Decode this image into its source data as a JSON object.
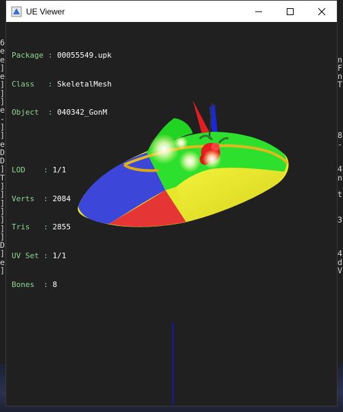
{
  "window": {
    "title": "UE Viewer",
    "minimize_icon": "minimize-icon",
    "maximize_icon": "maximize-icon",
    "close_icon": "close-icon"
  },
  "info": {
    "package_label": "Package",
    "package_value": "00055549.upk",
    "class_label": "Class",
    "class_value": "SkeletalMesh",
    "object_label": "Object",
    "object_value": "040342_GonM",
    "lod_label": "LOD",
    "lod_value": "1/1",
    "verts_label": "Verts",
    "verts_value": "2084",
    "tris_label": "Tris",
    "tris_value": "2855",
    "uvset_label": "UV Set",
    "uvset_value": "1/1",
    "bones_label": "Bones",
    "bones_value": "8"
  },
  "colors": {
    "label_green": "#8fd68f",
    "value_white": "#ffffff",
    "viewport_bg": "#202021",
    "axis_blue": "#1818a8"
  }
}
